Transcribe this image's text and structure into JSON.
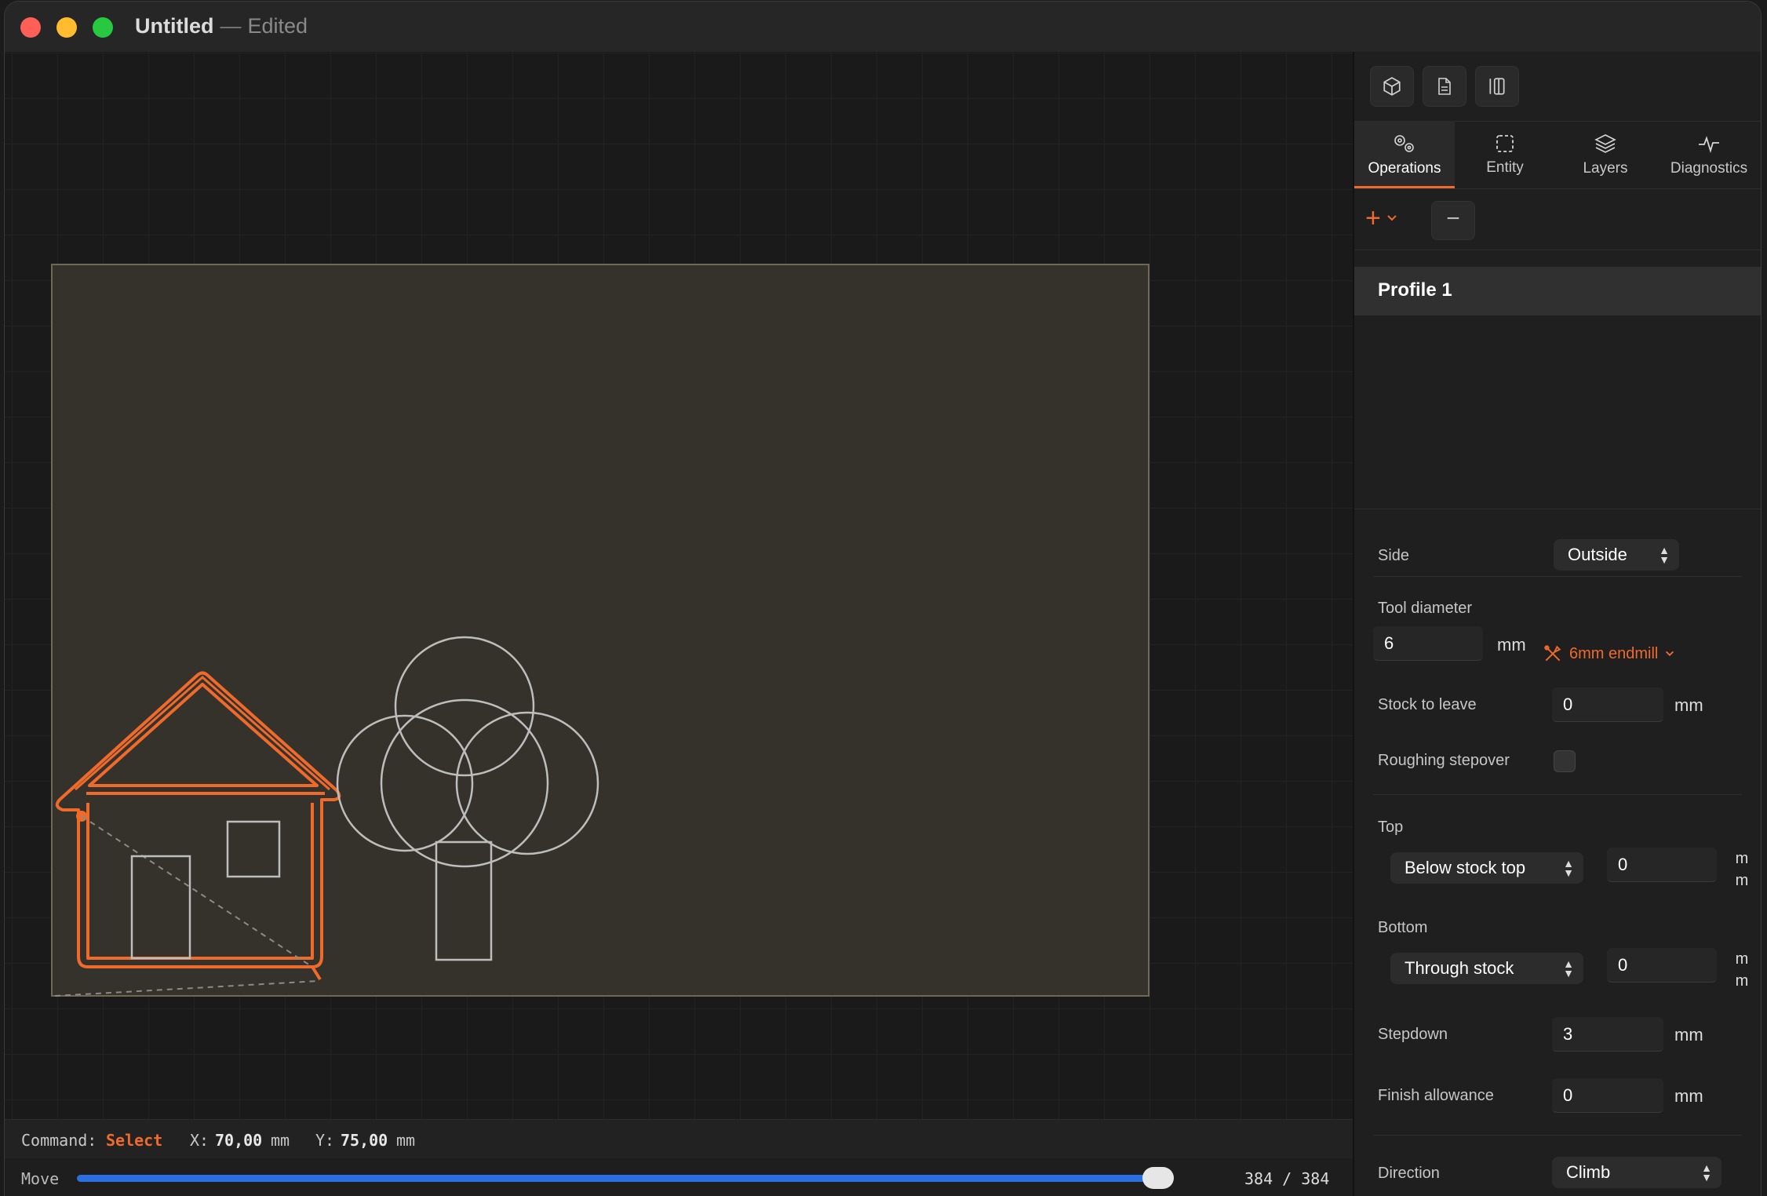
{
  "window": {
    "title": "Untitled",
    "separator": "—",
    "status": "Edited"
  },
  "panel": {
    "top_icons": [
      "cube-icon",
      "document-icon",
      "column-split-icon"
    ],
    "tabs": [
      {
        "label": "Operations",
        "icon": "gears-icon",
        "active": true
      },
      {
        "label": "Entity",
        "icon": "dashed-square-icon",
        "active": false
      },
      {
        "label": "Layers",
        "icon": "layers-icon",
        "active": false
      },
      {
        "label": "Diagnostics",
        "icon": "pulse-icon",
        "active": false
      }
    ],
    "add_symbol": "+",
    "remove_symbol": "−",
    "operations": [
      {
        "label": "Profile 1",
        "selected": true
      }
    ],
    "properties": {
      "side_label": "Side",
      "side_value": "Outside",
      "tool_diameter_label": "Tool diameter",
      "tool_diameter_value": "6",
      "tool_diameter_unit": "mm",
      "tool_name": "6mm endmill",
      "stock_to_leave_label": "Stock to leave",
      "stock_to_leave_value": "0",
      "stock_to_leave_unit": "mm",
      "roughing_stepover_label": "Roughing stepover",
      "roughing_stepover_checked": false,
      "top_label": "Top",
      "top_mode": "Below stock top",
      "top_value": "0",
      "top_unit_a": "m",
      "top_unit_b": "m",
      "bottom_label": "Bottom",
      "bottom_mode": "Through stock",
      "bottom_value": "0",
      "bottom_unit_a": "m",
      "bottom_unit_b": "m",
      "stepdown_label": "Stepdown",
      "stepdown_value": "3",
      "stepdown_unit": "mm",
      "finish_allowance_label": "Finish allowance",
      "finish_allowance_value": "0",
      "finish_allowance_unit": "mm",
      "direction_label": "Direction",
      "direction_value": "Climb"
    }
  },
  "status": {
    "command_label": "Command:",
    "command_value": "Select",
    "x_label": "X:",
    "x_value": "70,00",
    "x_unit": "mm",
    "y_label": "Y:",
    "y_value": "75,00",
    "y_unit": "mm"
  },
  "move": {
    "label": "Move",
    "current": 384,
    "total": 384,
    "count_text": "384 / 384",
    "progress_fraction": 1.0
  },
  "colors": {
    "accent": "#f06a2c",
    "slider": "#2b6fe3",
    "stock": "#37342c",
    "geometry": "#bdbdbd"
  }
}
